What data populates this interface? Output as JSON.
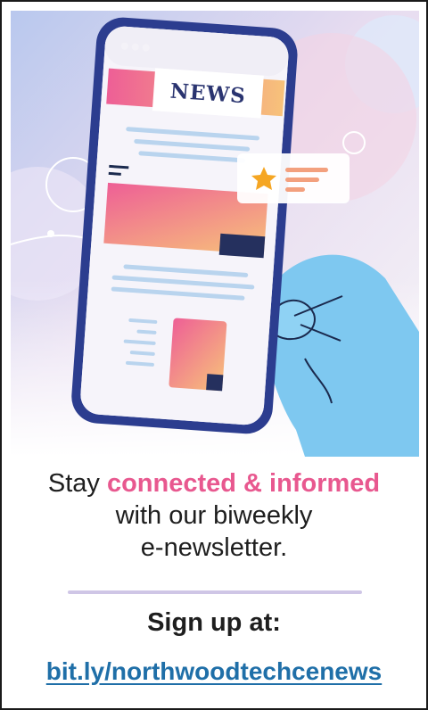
{
  "illustration": {
    "phone_label": "NEWS",
    "icons": [
      "star-icon",
      "phone-icon",
      "hand-icon"
    ]
  },
  "headline": {
    "prefix": "Stay ",
    "highlight": "connected & informed",
    "line2": "with our biweekly",
    "line3": "e-newsletter."
  },
  "cta": {
    "label": "Sign up at:",
    "link": "bit.ly/northwoodtechcenews"
  },
  "colors": {
    "highlight": "#e8588f",
    "link": "#1f6fa8",
    "divider": "#cfc6e6",
    "hand": "#7ec8f0",
    "phone_frame": "#2c3d8f"
  }
}
